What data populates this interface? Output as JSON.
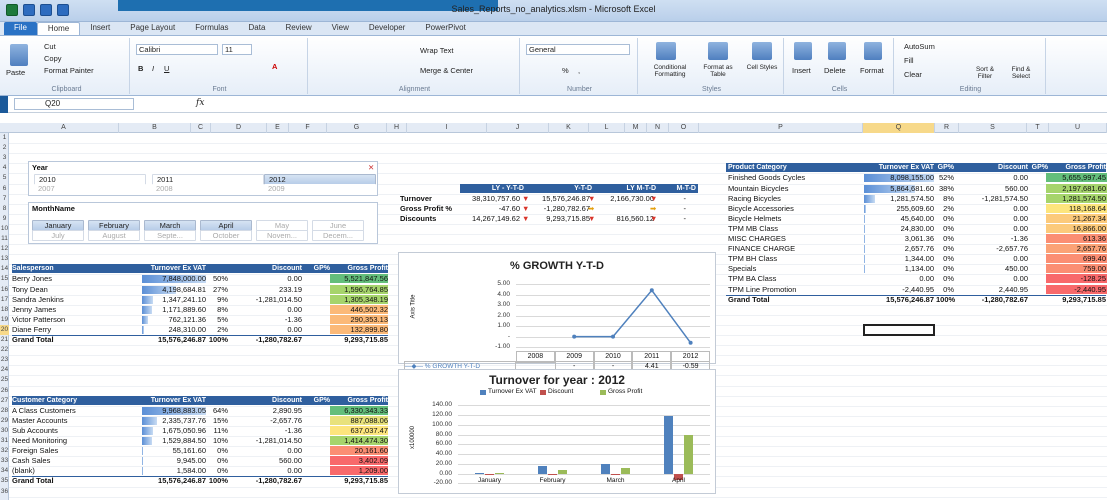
{
  "window": {
    "title": "Sales_Reports_no_analytics.xlsm - Microsoft Excel"
  },
  "tabs": [
    "File",
    "Home",
    "Insert",
    "Page Layout",
    "Formulas",
    "Data",
    "Review",
    "View",
    "Developer",
    "PowerPivot"
  ],
  "ribbon": {
    "clipboard": {
      "paste": "Paste",
      "cut": "Cut",
      "copy": "Copy",
      "format_painter": "Format Painter",
      "label": "Clipboard"
    },
    "font": {
      "name": "Calibri",
      "size": "11",
      "label": "Font"
    },
    "alignment": {
      "wrap": "Wrap Text",
      "merge": "Merge & Center",
      "label": "Alignment"
    },
    "number": {
      "format": "General",
      "pct": "%",
      "comma": ",",
      "label": "Number"
    },
    "styles": {
      "conditional": "Conditional Formatting",
      "format_table": "Format as Table",
      "cell_styles": "Cell Styles",
      "label": "Styles"
    },
    "cells": {
      "insert": "Insert",
      "delete": "Delete",
      "format": "Format",
      "label": "Cells"
    },
    "editing": {
      "autosum": "AutoSum",
      "fill": "Fill",
      "clear": "Clear",
      "sort": "Sort & Filter",
      "find": "Find & Select",
      "label": "Editing"
    }
  },
  "formula_bar": {
    "name_box": "Q20",
    "fx": "fx",
    "value": ""
  },
  "columns": [
    "A",
    "B",
    "C",
    "D",
    "E",
    "F",
    "G",
    "H",
    "I",
    "J",
    "K",
    "L",
    "M",
    "N",
    "O",
    "P",
    "Q",
    "R",
    "S",
    "T",
    "U"
  ],
  "rows": [
    "1",
    "2",
    "3",
    "4",
    "5",
    "6",
    "7",
    "8",
    "9",
    "10",
    "11",
    "12",
    "13",
    "14",
    "15",
    "16",
    "17",
    "18",
    "19",
    "20",
    "21",
    "22",
    "23",
    "24",
    "25",
    "26",
    "27",
    "28",
    "29",
    "30",
    "31",
    "32",
    "33",
    "34",
    "35",
    "36"
  ],
  "year_slicer": {
    "title": "Year",
    "items": [
      {
        "label": "2010",
        "on": true
      },
      {
        "label": "2011",
        "on": true
      },
      {
        "label": "2012",
        "on": true
      },
      {
        "label": "2007",
        "on": false
      },
      {
        "label": "2008",
        "on": false
      },
      {
        "label": "2009",
        "on": false
      }
    ]
  },
  "month_slicer": {
    "title": "MonthName",
    "items": [
      {
        "label": "January",
        "on": true
      },
      {
        "label": "February",
        "on": true
      },
      {
        "label": "March",
        "on": true
      },
      {
        "label": "April",
        "on": true
      },
      {
        "label": "May",
        "on": false
      },
      {
        "label": "June",
        "on": false
      },
      {
        "label": "July",
        "on": false
      },
      {
        "label": "August",
        "on": false
      },
      {
        "label": "Septe...",
        "on": false
      },
      {
        "label": "October",
        "on": false
      },
      {
        "label": "Novem...",
        "on": false
      },
      {
        "label": "Decem...",
        "on": false
      }
    ]
  },
  "salesperson_table": {
    "headers": [
      "Salesperson",
      "Turnover Ex VAT",
      "Discount",
      "GP%",
      "Gross Profit"
    ],
    "rows": [
      [
        "Berry Jones",
        "7,848,000.00",
        "50%",
        "0.00",
        "5,521,847.56"
      ],
      [
        "Tony Dean",
        "4,198,684.81",
        "27%",
        "233.19",
        "1,596,764.85"
      ],
      [
        "Sandra Jenkins",
        "1,347,241.10",
        "9%",
        "-1,281,014.50",
        "1,305,348.19"
      ],
      [
        "Jenny James",
        "1,171,889.60",
        "8%",
        "0.00",
        "446,502.32"
      ],
      [
        "Victor Patterson",
        "762,121.36",
        "5%",
        "-1.36",
        "290,353.13"
      ],
      [
        "Diane Ferry",
        "248,310.00",
        "2%",
        "0.00",
        "132,899.80"
      ]
    ],
    "total": [
      "Grand Total",
      "15,576,246.87",
      "100%",
      "-1,280,782.67",
      "9,293,715.85"
    ]
  },
  "customer_table": {
    "headers": [
      "Customer Category",
      "Turnover Ex VAT",
      "Discount",
      "GP%",
      "Gross Profit"
    ],
    "rows": [
      [
        "A Class Customers",
        "9,968,883.05",
        "64%",
        "2,890.95",
        "6,330,343.33"
      ],
      [
        "Master Accounts",
        "2,335,737.76",
        "15%",
        "-2,657.76",
        "887,088.06"
      ],
      [
        "Sub Accounts",
        "1,675,050.96",
        "11%",
        "-1.36",
        "637,037.47"
      ],
      [
        "Need Monitoring",
        "1,529,884.50",
        "10%",
        "-1,281,014.50",
        "1,414,474.30"
      ],
      [
        "Foreign Sales",
        "55,161.60",
        "0%",
        "0.00",
        "20,161.60"
      ],
      [
        "Cash Sales",
        "9,945.00",
        "0%",
        "560.00",
        "3,402.09"
      ],
      [
        "(blank)",
        "1,584.00",
        "0%",
        "0.00",
        "1,209.00"
      ]
    ],
    "total": [
      "Grand Total",
      "15,576,246.87",
      "100%",
      "-1,280,782.67",
      "9,293,715.85"
    ]
  },
  "kpi_table": {
    "headers": [
      "LY - Y-T-D",
      "Y-T-D",
      "LY M-T-D",
      "M-T-D"
    ],
    "rows": [
      [
        "Turnover",
        "38,310,757.60",
        "15,576,246.87",
        "2,166,730.00",
        "-"
      ],
      [
        "Gross Profit %",
        "-47.60",
        "-1,280,782.67",
        "-",
        "-"
      ],
      [
        "Discounts",
        "14,267,149.62",
        "9,293,715.85",
        "816,560.12",
        "-"
      ]
    ]
  },
  "product_table": {
    "headers": [
      "Product Category",
      "Turnover Ex VAT",
      "GP%",
      "Discount",
      "GP%",
      "Gross Profit"
    ],
    "rows": [
      [
        "Finished Goods Cycles",
        "8,098,155.00",
        "52%",
        "0.00",
        "5,655,997.45"
      ],
      [
        "Mountain Bicycles",
        "5,864,681.60",
        "38%",
        "560.00",
        "2,197,681.60"
      ],
      [
        "Racing Bicycles",
        "1,281,574.50",
        "8%",
        "-1,281,574.50",
        "1,281,574.50"
      ],
      [
        "Bicycle Accessories",
        "255,609.60",
        "2%",
        "0.00",
        "118,168.64"
      ],
      [
        "Bicycle Helmets",
        "45,640.00",
        "0%",
        "0.00",
        "21,267.34"
      ],
      [
        "TPM MB Class",
        "24,830.00",
        "0%",
        "0.00",
        "16,866.00"
      ],
      [
        "MISC CHARGES",
        "3,061.36",
        "0%",
        "-1.36",
        "613.36"
      ],
      [
        "FINANCE CHARGE",
        "2,657.76",
        "0%",
        "-2,657.76",
        "2,657.76"
      ],
      [
        "TPM BH Class",
        "1,344.00",
        "0%",
        "0.00",
        "699.40"
      ],
      [
        "Specials",
        "1,134.00",
        "0%",
        "450.00",
        "759.00"
      ],
      [
        "TPM BA Class",
        "0.00",
        "0%",
        "0.00",
        "-128.25"
      ],
      [
        "TPM Line Promotion",
        "-2,440.95",
        "0%",
        "2,440.95",
        "-2,440.95"
      ]
    ],
    "total": [
      "Grand Total",
      "15,576,246.87",
      "100%",
      "-1,280,782.67",
      "9,293,715.85"
    ]
  },
  "chart_data": [
    {
      "type": "line",
      "title": "% GROWTH Y-T-D",
      "ylabel": "Axis Title",
      "categories": [
        "2008",
        "2009",
        "2010",
        "2011",
        "2012"
      ],
      "series": [
        {
          "name": "% GROWTH Y-T-D",
          "values": [
            null,
            0,
            0,
            4.41,
            -0.59
          ]
        }
      ],
      "table_row": [
        "",
        "-",
        "-",
        "4.41",
        "-0.59"
      ],
      "ylim": [
        -1,
        5
      ],
      "yticks": [
        "5.00",
        "4.00",
        "3.00",
        "2.00",
        "1.00",
        "-",
        "-1.00"
      ],
      "grid": true
    },
    {
      "type": "bar",
      "title": "Turnover for year : 2012",
      "ylabel": "x100000",
      "categories": [
        "January",
        "February",
        "March",
        "April"
      ],
      "series": [
        {
          "name": "Turnover Ex VAT",
          "color": "#4f81bd",
          "values": [
            1.5,
            15,
            20,
            118
          ]
        },
        {
          "name": "Discount",
          "color": "#c0504d",
          "values": [
            0,
            0,
            0,
            -12.8
          ]
        },
        {
          "name": "Gross Profit",
          "color": "#9bbb59",
          "values": [
            1,
            8,
            11,
            79
          ]
        }
      ],
      "yticks": [
        "140.00",
        "120.00",
        "100.00",
        "80.00",
        "60.00",
        "40.00",
        "20.00",
        "0.00",
        "-20.00"
      ],
      "ylim": [
        -20,
        140
      ],
      "grid": true
    }
  ]
}
